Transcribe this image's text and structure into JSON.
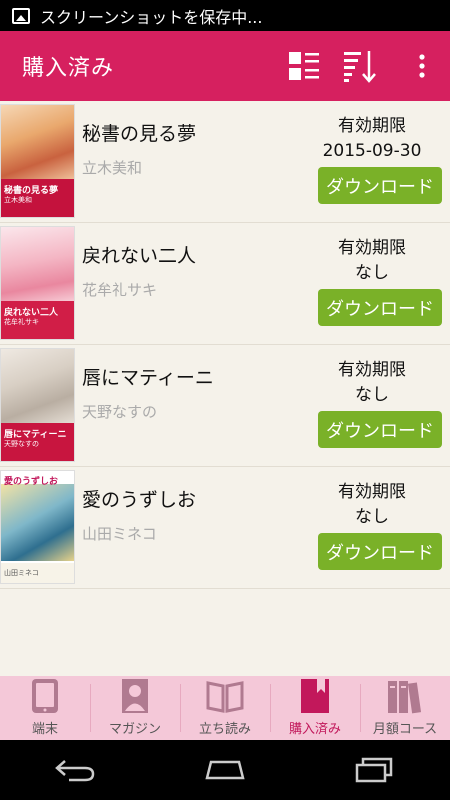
{
  "status_bar": {
    "notification": "スクリーンショットを保存中..."
  },
  "app_bar": {
    "title": "購入済み"
  },
  "books": [
    {
      "title": "秘書の見る夢",
      "author": "立木美和",
      "expiry_label": "有効期限",
      "expiry_value": "2015-09-30",
      "button": "ダウンロード",
      "cover_title": "秘書の見る夢",
      "cover_author": "立木美和"
    },
    {
      "title": "戻れない二人",
      "author": "花牟礼サキ",
      "expiry_label": "有効期限",
      "expiry_value": "なし",
      "button": "ダウンロード",
      "cover_title": "戻れない二人",
      "cover_author": "花牟礼サキ"
    },
    {
      "title": "唇にマティーニ",
      "author": "天野なすの",
      "expiry_label": "有効期限",
      "expiry_value": "なし",
      "button": "ダウンロード",
      "cover_title": "唇にマティーニ",
      "cover_author": "天野なすの"
    },
    {
      "title": "愛のうずしお",
      "author": "山田ミネコ",
      "expiry_label": "有効期限",
      "expiry_value": "なし",
      "button": "ダウンロード",
      "cover_title": "愛のうずしお",
      "cover_author": "山田ミネコ"
    }
  ],
  "tabs": [
    {
      "label": "端末",
      "icon": "tablet-icon"
    },
    {
      "label": "マガジン",
      "icon": "magazine-icon"
    },
    {
      "label": "立ち読み",
      "icon": "open-book-icon"
    },
    {
      "label": "購入済み",
      "icon": "bookmark-book-icon",
      "active": true
    },
    {
      "label": "月額コース",
      "icon": "bookshelf-icon"
    }
  ],
  "colors": {
    "accent": "#d6205f",
    "download": "#7ab128",
    "tab_bar": "#f4c8d8",
    "active_tab": "#c2185b"
  }
}
